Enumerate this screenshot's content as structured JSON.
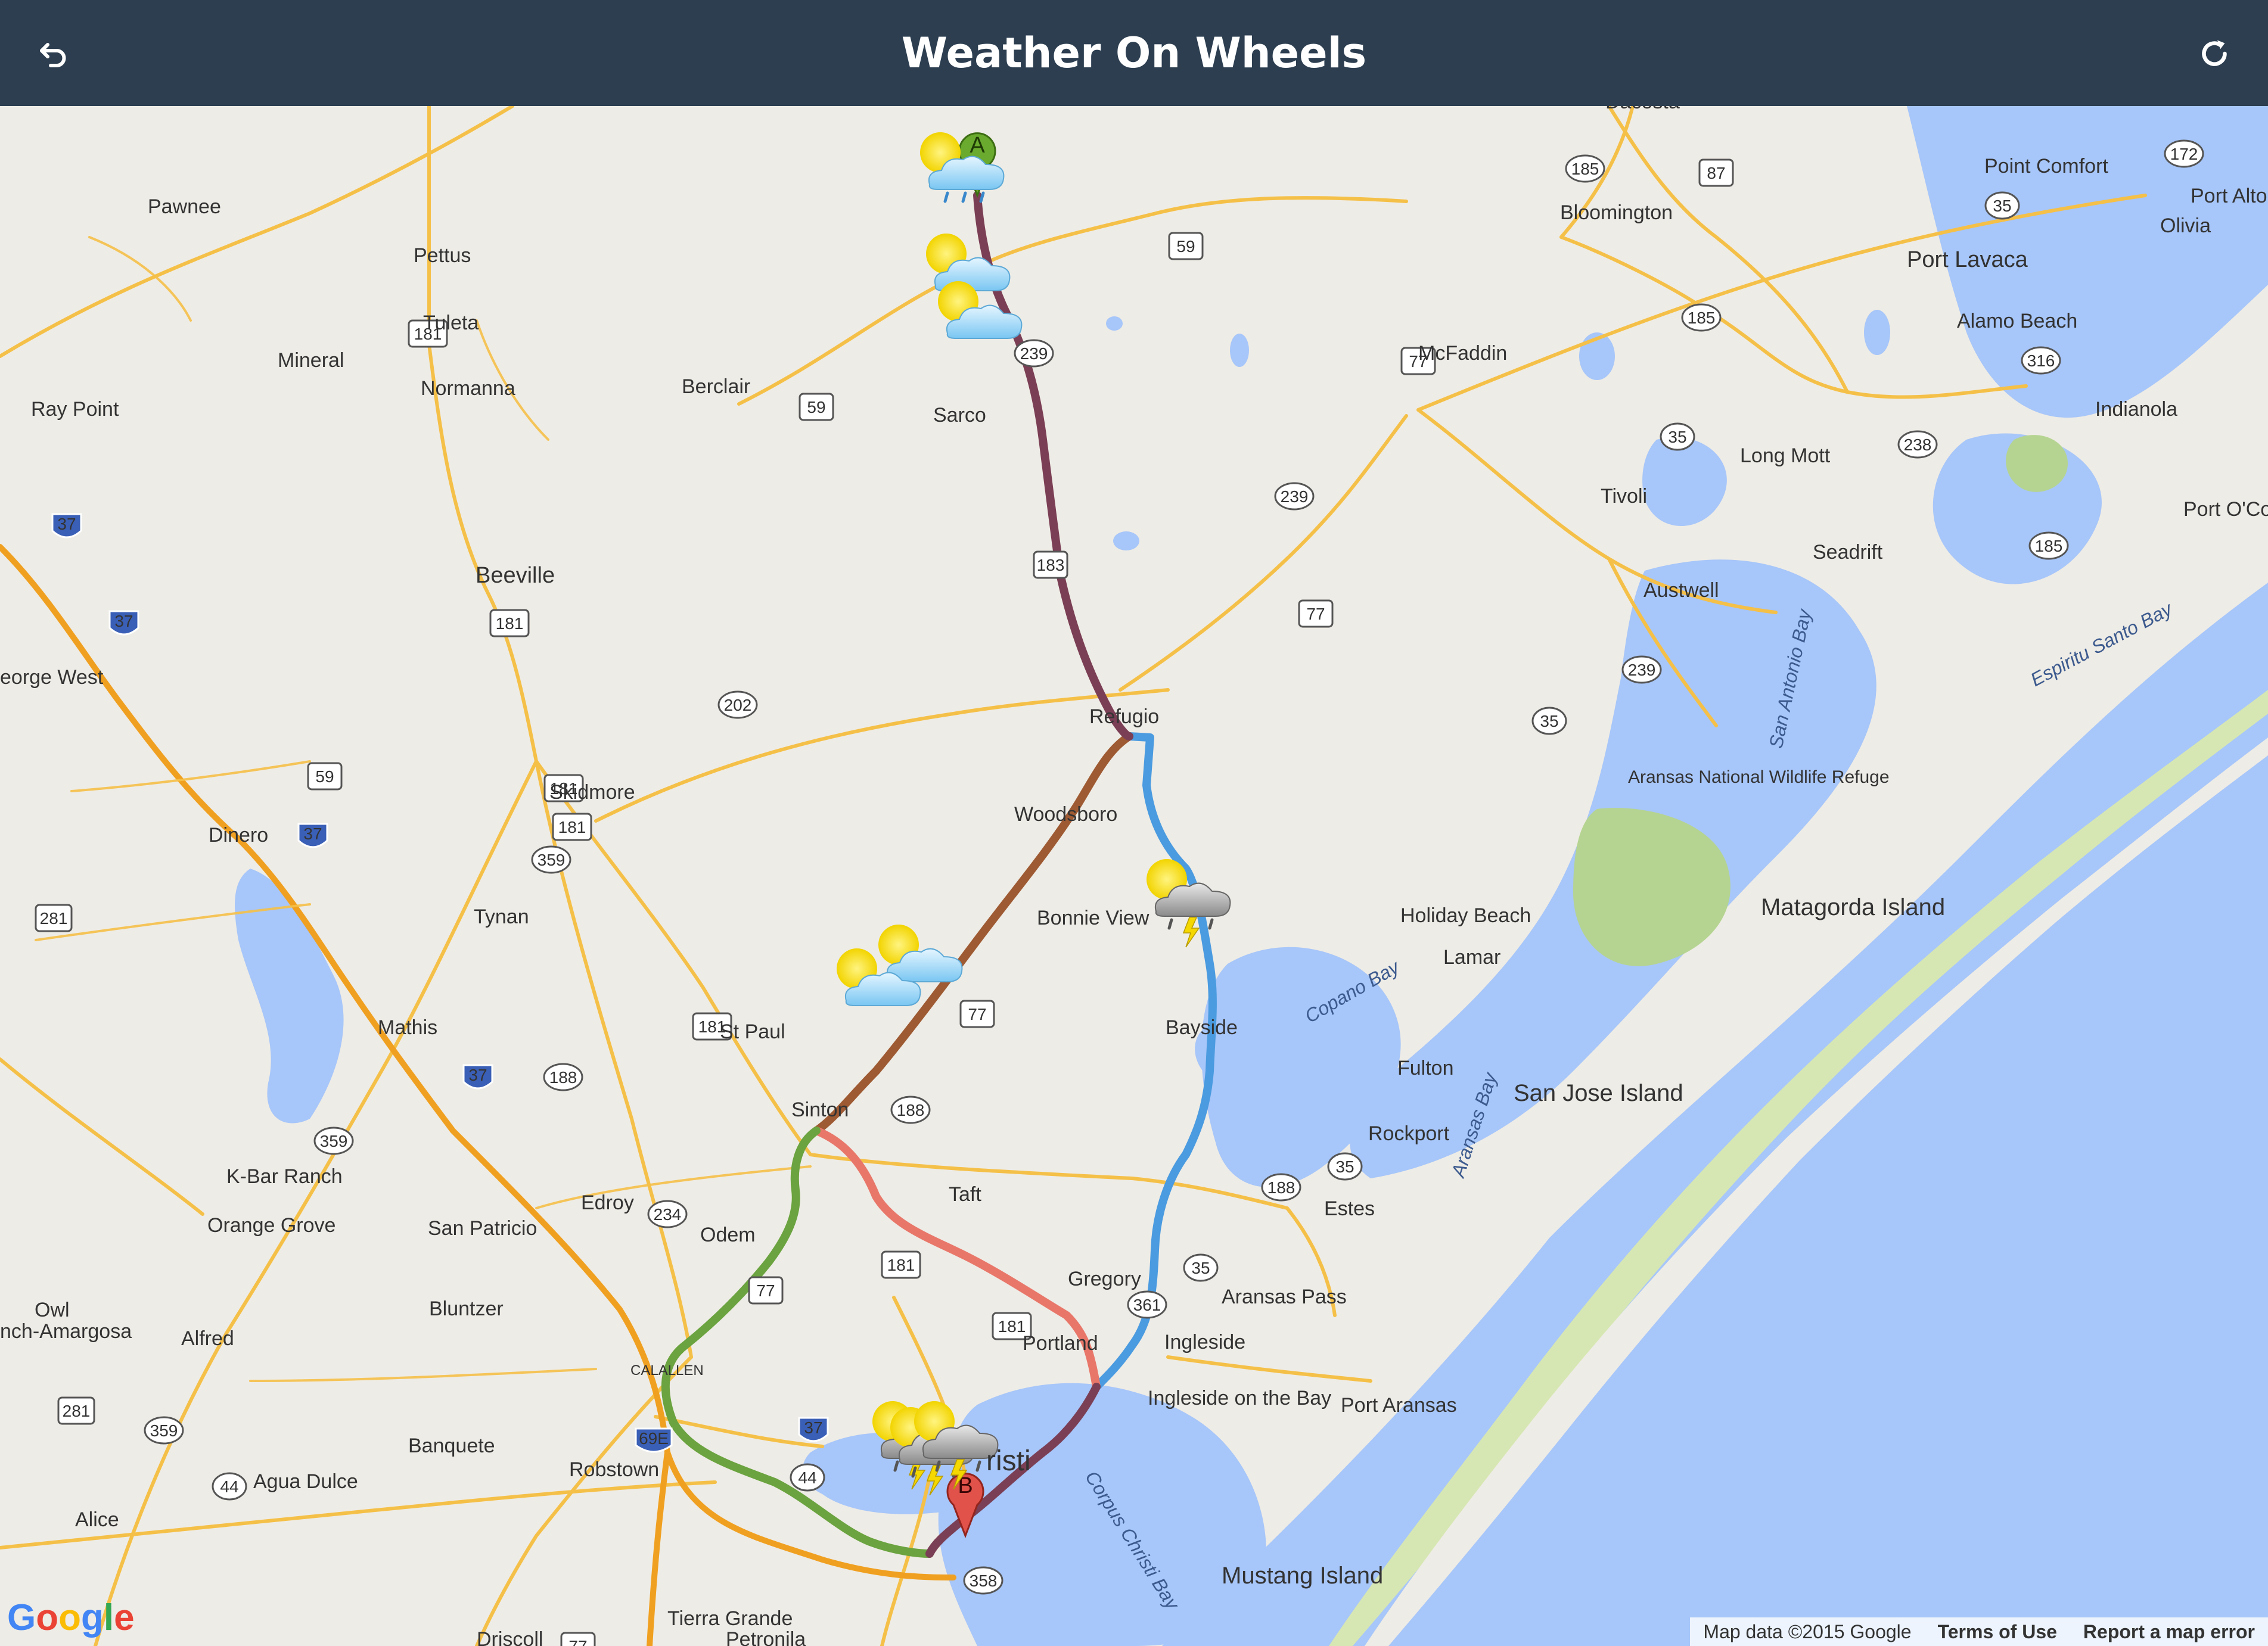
{
  "app": {
    "title": "Weather On Wheels"
  },
  "header": {
    "back_icon": "undo-icon",
    "refresh_icon": "refresh-icon"
  },
  "map": {
    "markers": {
      "start": "A",
      "end": "B"
    },
    "cities": [
      "Pawnee",
      "Pettus",
      "Tuleta",
      "Mineral",
      "Normanna",
      "Berclair",
      "Ray Point",
      "Sarco",
      "Beeville",
      "eorge West",
      "Refugio",
      "Skidmore",
      "Woodsboro",
      "Dinero",
      "Tynan",
      "Bonnie View",
      "Mathis",
      "St Paul",
      "Sinton",
      "Bayside",
      "K-Bar Ranch",
      "Edroy",
      "Taft",
      "Orange Grove",
      "San Patricio",
      "Odem",
      "Gregory",
      "Owl",
      "nch-Amargosa",
      "Bluntzer",
      "Alfred",
      "Portland",
      "Ingleside",
      "Aransas Pass",
      "Ingleside on the Bay",
      "Port Aransas",
      "Banquete",
      "Robstown",
      "Agua Dulce",
      "Alice",
      "Tierra Grande",
      "Driscoll",
      "Petronila",
      "Dacosta",
      "Bloomington",
      "McFaddin",
      "Point Comfort",
      "Port Lavaca",
      "Olivia",
      "Port Alto",
      "Alamo Beach",
      "Indianola",
      "Long Mott",
      "Tivoli",
      "Seadrift",
      "Port O'Co",
      "Austwell",
      "Holiday Beach",
      "Lamar",
      "Fulton",
      "Rockport",
      "Estes",
      "San Jose Island",
      "Matagorda Island",
      "Mustang Island",
      "Aransas National Wildlife Refuge",
      "CALALLEN",
      "risti"
    ],
    "water_labels": [
      "Copano Bay",
      "Aransas Bay",
      "San Antonio Bay",
      "Espiritu Santo Bay",
      "Corpus Christi Bay"
    ],
    "route_colors": {
      "route1": "#7b3f55",
      "route2": "#4a9be0",
      "route3": "#9e5a32",
      "route4": "#e8776a",
      "route5": "#6aa33f"
    },
    "weather_icons": [
      "partly-cloudy-rain-icon",
      "partly-cloudy-icon",
      "partly-cloudy-icon",
      "thunderstorm-icon",
      "partly-cloudy-icon",
      "partly-cloudy-icon",
      "thunderstorm-icon",
      "thunderstorm-icon",
      "thunderstorm-icon"
    ]
  },
  "footer": {
    "map_data": "Map data ©2015 Google",
    "terms": "Terms of Use",
    "report": "Report a map error"
  },
  "logo": "Google"
}
